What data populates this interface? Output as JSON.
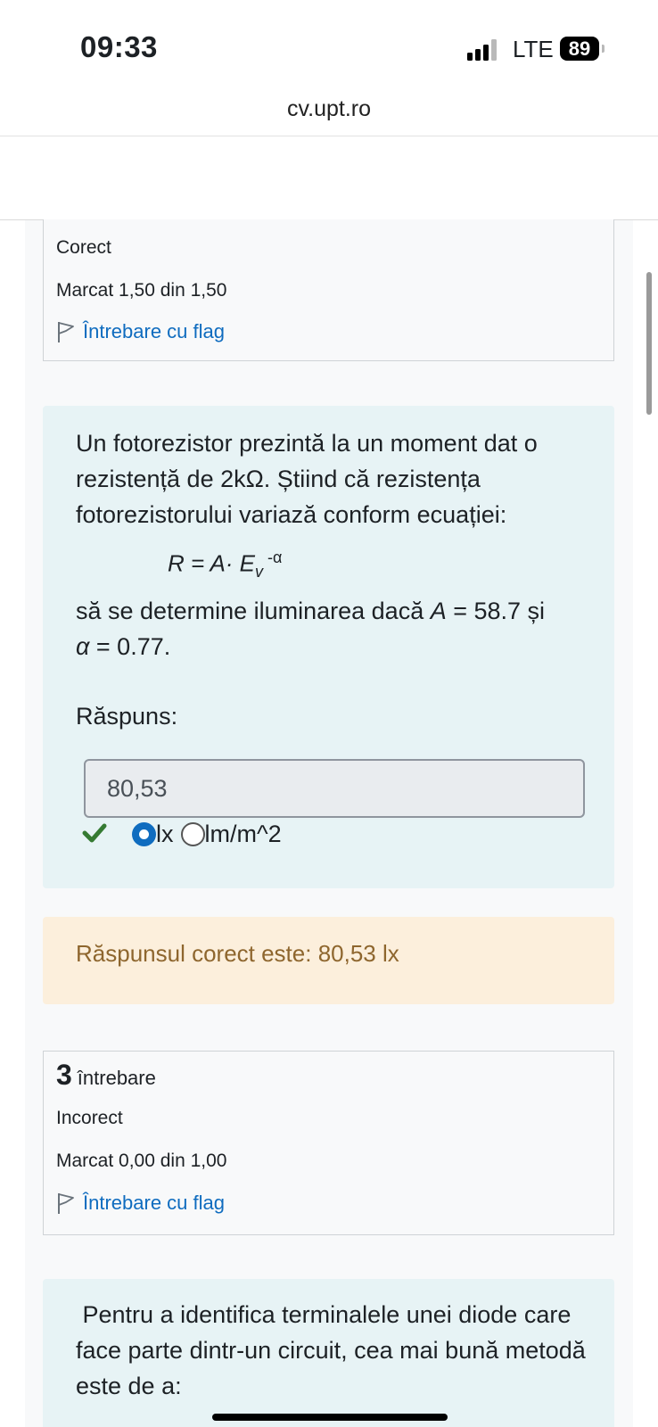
{
  "status_bar": {
    "time": "09:33",
    "network": "LTE",
    "battery": "89"
  },
  "browser": {
    "url": "cv.upt.ro"
  },
  "question2_info": {
    "state": "Corect",
    "mark": "Marcat 1,50 din 1,50",
    "flag_label": "Întrebare cu flag"
  },
  "question2": {
    "text": "Un fotorezistor prezintă la un moment dat o rezistență de 2kΩ. Știind că rezistența fotorezistorului variază conform ecuației:",
    "formula": {
      "lhs": "R = A· E",
      "subscript": "v",
      "exponent": " -α"
    },
    "text2_prefix": "să se determine iluminarea dacă ",
    "A_var": "A",
    "A_value": " = 58.7 și",
    "alpha_var": "α",
    "alpha_value": " = 0.77.",
    "answer_label": "Răspuns:",
    "answer_value": "80,53",
    "units": [
      {
        "label": "lx",
        "selected": true
      },
      {
        "label": "lm/m^2",
        "selected": false
      }
    ],
    "feedback": "Răspunsul corect este: 80,53 lx"
  },
  "question3_info": {
    "number": "3",
    "number_suffix": "întrebare",
    "state": "Incorect",
    "mark": "Marcat 0,00 din 1,00",
    "flag_label": "Întrebare cu flag"
  },
  "question3": {
    "text": " Pentru a identifica terminalele unei diode care face parte dintr-un circuit, cea mai bună metodă este de a:"
  },
  "colors": {
    "link": "#0f6cbf",
    "question_bg": "#e7f3f5",
    "feedback_bg": "#fcefdc",
    "feedback_text": "#8e662e",
    "correct_check": "#357a32"
  }
}
